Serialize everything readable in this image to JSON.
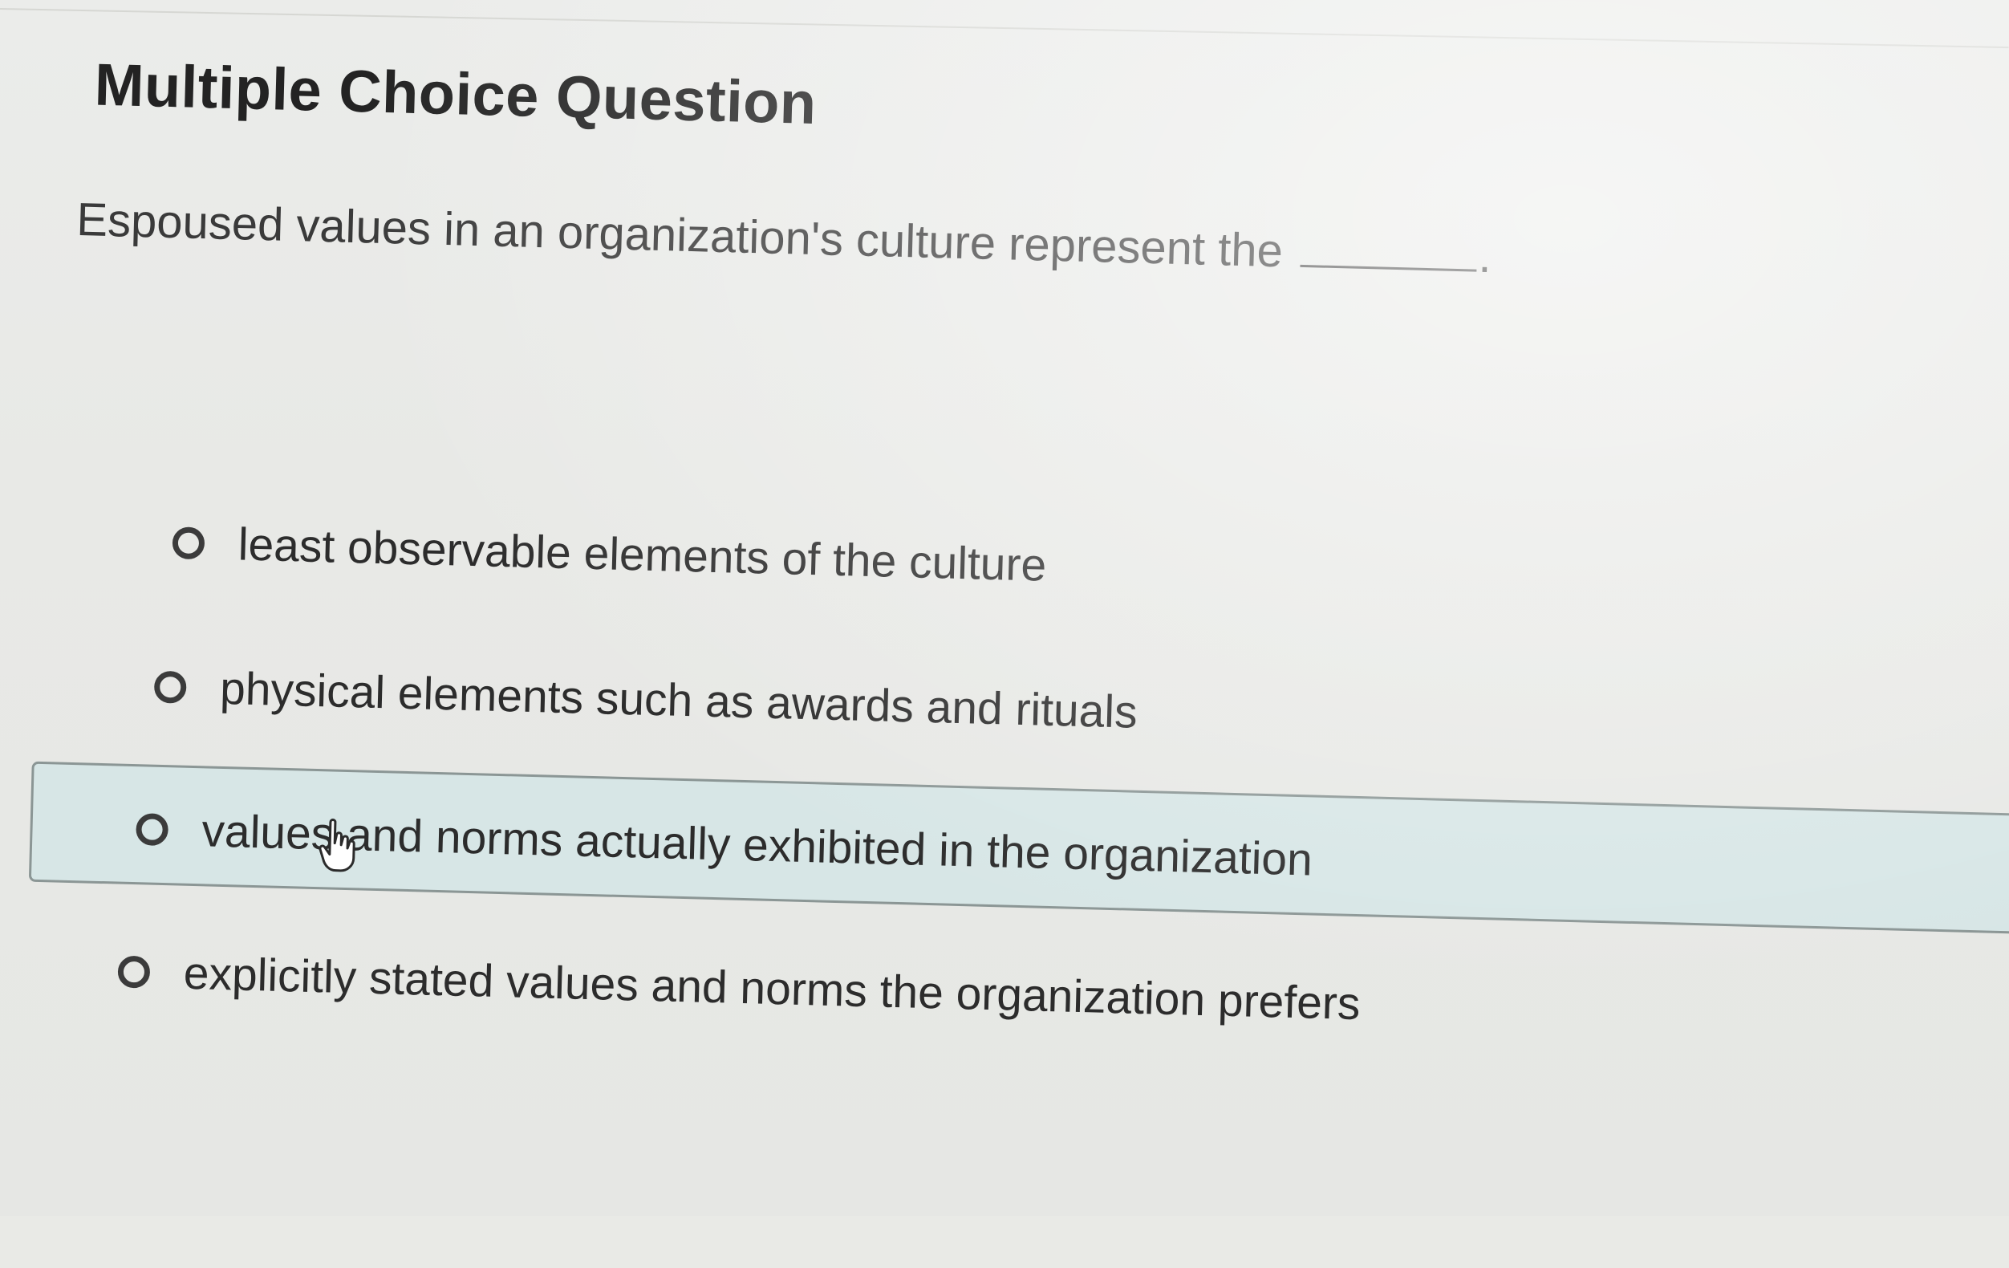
{
  "question": {
    "heading": "Multiple Choice Question",
    "prompt": "Espoused values in an organization's culture represent the",
    "prompt_end": "."
  },
  "options": [
    {
      "label": "least observable elements of the culture",
      "selected": false,
      "hovered": false
    },
    {
      "label": "physical elements such as awards and rituals",
      "selected": false,
      "hovered": false
    },
    {
      "label": "values and norms actually exhibited in the organization",
      "selected": false,
      "hovered": true
    },
    {
      "label": "explicitly stated values and norms the organization prefers",
      "selected": false,
      "hovered": false
    }
  ],
  "icons": {
    "radio": "radio-button-icon",
    "cursor": "hand-pointer-icon"
  },
  "colors": {
    "hover_background": "#d7e6e6",
    "hover_border": "#8b9695",
    "text": "#2c2c2c"
  }
}
